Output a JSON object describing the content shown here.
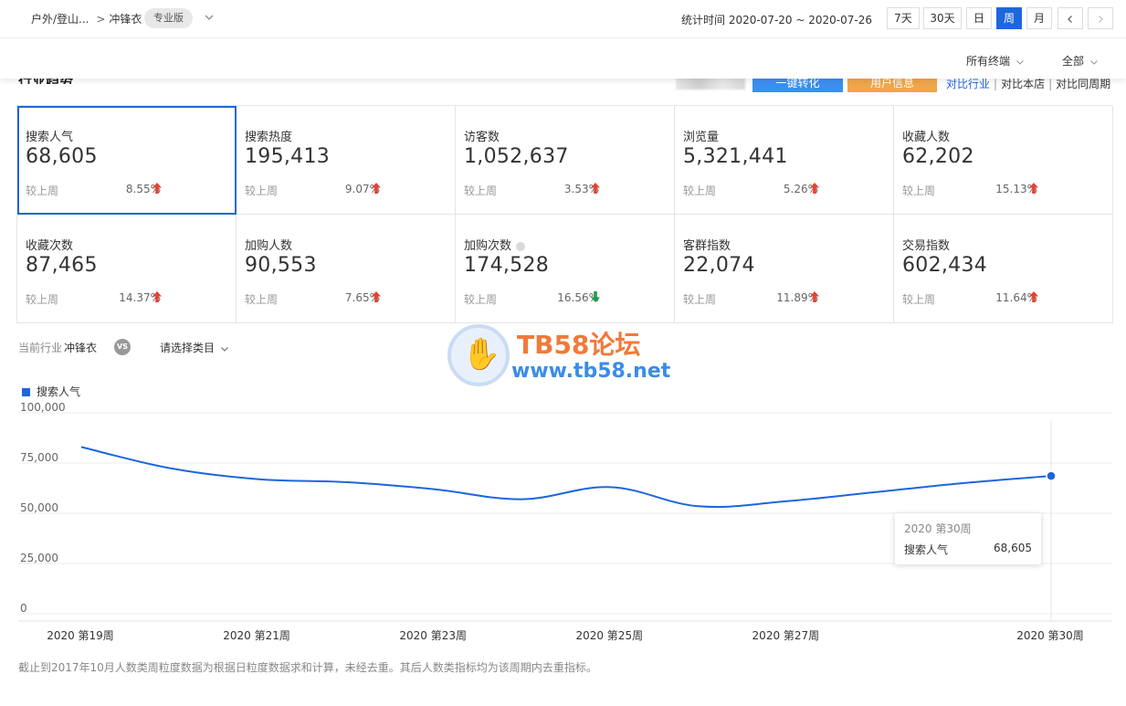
{
  "header": {
    "breadcrumb_category": "户外/登山...",
    "breadcrumb_sep": ">",
    "breadcrumb_item": "冲锋衣",
    "edition_badge": "专业版",
    "stat_time_label": "统计时间 2020-07-20 ~ 2020-07-26",
    "ranges": [
      "7天",
      "30天",
      "日",
      "周",
      "月"
    ],
    "active_range": "周"
  },
  "filters": {
    "terminal": "所有终端",
    "scope": "全部"
  },
  "section": {
    "title": "行业趋势",
    "convert_button": "一键转化",
    "user_info_button": "用户信息",
    "compare_links": [
      "对比行业",
      "对比本店",
      "对比同周期"
    ]
  },
  "metrics": [
    {
      "label": "搜索人气",
      "value": "68,605",
      "compare": "较上周",
      "pct": "8.55%",
      "trend": "up",
      "selected": true
    },
    {
      "label": "搜索热度",
      "value": "195,413",
      "compare": "较上周",
      "pct": "9.07%",
      "trend": "up"
    },
    {
      "label": "访客数",
      "value": "1,052,637",
      "compare": "较上周",
      "pct": "3.53%",
      "trend": "up"
    },
    {
      "label": "浏览量",
      "value": "5,321,441",
      "compare": "较上周",
      "pct": "5.26%",
      "trend": "up"
    },
    {
      "label": "收藏人数",
      "value": "62,202",
      "compare": "较上周",
      "pct": "15.13%",
      "trend": "up"
    },
    {
      "label": "收藏次数",
      "value": "87,465",
      "compare": "较上周",
      "pct": "14.37%",
      "trend": "up"
    },
    {
      "label": "加购人数",
      "value": "90,553",
      "compare": "较上周",
      "pct": "7.65%",
      "trend": "up"
    },
    {
      "label": "加购次数",
      "value": "174,528",
      "compare": "较上周",
      "pct": "16.56%",
      "trend": "down",
      "info": true
    },
    {
      "label": "客群指数",
      "value": "22,074",
      "compare": "较上周",
      "pct": "11.89%",
      "trend": "up"
    },
    {
      "label": "交易指数",
      "value": "602,434",
      "compare": "较上周",
      "pct": "11.64%",
      "trend": "up"
    }
  ],
  "industry": {
    "current_label": "当前行业",
    "current_value": "冲锋衣",
    "vs": "VS",
    "select_placeholder": "请选择类目"
  },
  "watermark": {
    "title": "TB58论坛",
    "url": "www.tb58.net"
  },
  "colors": {
    "accent": "#1d66dc",
    "up": "#e8412f",
    "down": "#1f9d4c"
  },
  "chart_data": {
    "type": "line",
    "x": [
      "2020 第19周",
      "2020 第20周",
      "2020 第21周",
      "2020 第22周",
      "2020 第23周",
      "2020 第24周",
      "2020 第25周",
      "2020 第26周",
      "2020 第27周",
      "2020 第28周",
      "2020 第29周",
      "2020 第30周"
    ],
    "x_tick_labels": [
      "2020 第19周",
      "2020 第21周",
      "2020 第23周",
      "2020 第25周",
      "2020 第27周",
      "2020 第30周"
    ],
    "series": [
      {
        "name": "搜索人气",
        "values": [
          83000,
          72500,
          67000,
          65500,
          62000,
          57000,
          63000,
          53500,
          56000,
          60500,
          65000,
          68605
        ]
      }
    ],
    "y_ticks": [
      "100,000",
      "75,000",
      "50,000",
      "25,000",
      "0"
    ],
    "ylim": [
      0,
      100000
    ],
    "grid": true,
    "legend": "top-left",
    "tooltip": {
      "title": "2020 第30周",
      "name": "搜索人气",
      "value": "68,605"
    }
  },
  "footnote": "截止到2017年10月人数类周粒度数据为根据日粒度数据求和计算，未经去重。其后人数类指标均为该周期内去重指标。"
}
